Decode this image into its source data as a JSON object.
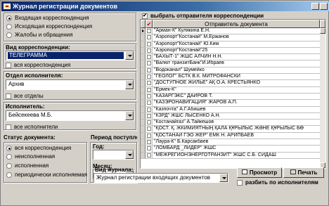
{
  "window": {
    "title": "Журнал регистрации документов"
  },
  "direction": {
    "options": [
      "Входящая корреспонденция",
      "Исходящая корреспонденция",
      "Жалобы и обращения"
    ],
    "selected": 0
  },
  "correspondence_type": {
    "label": "Вид корреспонденции:",
    "value": "ТЕЛЕГРАММА",
    "all_label": "вся корреспонденция"
  },
  "department": {
    "label": "Отдел исполнителя:",
    "value": "Архив",
    "all_label": "все отделы"
  },
  "executor": {
    "label": "Исполнитель:",
    "value": "Бейсекеева М.Б.",
    "all_label": "все исполнители"
  },
  "status": {
    "label": "Статус документа:",
    "options": [
      "вся корреспонденция",
      "неисполненная",
      "исполненная",
      "периодически исполняемая"
    ],
    "selected": 0
  },
  "period": {
    "label": "Период поступления",
    "year_label": "Год:",
    "month_label": "Месяц:"
  },
  "sender": {
    "select_label": "выбрать отправителя корреспонденции",
    "column_header": "Отправитель документа",
    "rows": [
      "\"Арман-К\" Кулякина Е.Н.",
      "\"Аэропорт\"Костанай\" М.Ержанов",
      "\"Аэропорт\"Костанай\" Ю.Ким",
      "\"Аэропорт\"Костанай\"25",
      "\"БАХЫТ-1\" ЖШС АЛЧИН Н.Н.",
      "\"Валют транзитБанк\"И.Ибраев",
      "\"Водоканал\" Шумейко",
      "\"ГЕОЛОГ\" БСТК В.К. МИТРОФАНСКИ",
      "\"ДОСТУПНОЕ ЖИЛЬЕ\" АҚ О.А. КРЕСТЬЯНКО",
      "\"Ермек-К\"",
      "\"КАЗАРГЭКС\" ДАЙРОВ Т.",
      "\"КАЗЭРОНАВИГАЦИЯ\" ЖАРОВ А.П.",
      "\"Казпочта\" А.Г.Абишев",
      "\"КЗРД\" ЖШС ЛЫСЕНКО А.Н.",
      "\"Костанайгаз\" А.Тайкешов",
      "\"ҚОСТ. Қ. ЖКИМИЯТНЫҢ ҚАЛА ҚҰРЫЛЫС ЖӘНЕ ҚҰРЫЛЫС БӨ",
      "\"ҚОСТАНАЙ ГЭО ЖЕР\" ЕМК Н. АРИПБАЕВ",
      "\"Лаура-К\" Б.Карсакбаев",
      "\"ЛОМБАРД _ЛИДЕР\" ЖШС",
      "\"МЕЖРЕГИОНЭНЕРГОТРАНЗИТ\" ЖШС С.Б. СИДАШ"
    ]
  },
  "journal": {
    "label": "Вид журнала:",
    "value": "Журнал регистрации входящих документов"
  },
  "actions": {
    "view_label": "Просмотр",
    "print_label": "Печать",
    "split_label": "разбить по исполнителям"
  }
}
